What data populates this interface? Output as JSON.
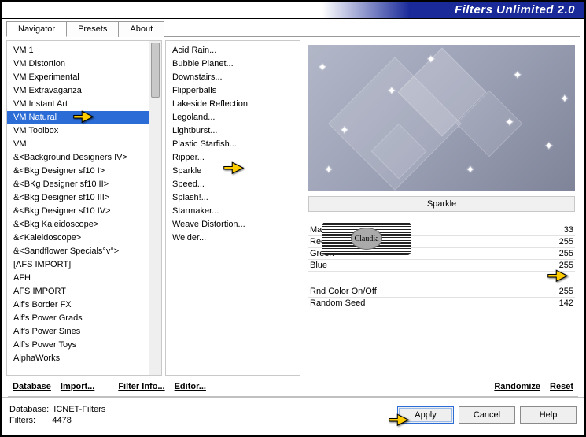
{
  "title": "Filters Unlimited 2.0",
  "tabs": [
    {
      "label": "Navigator",
      "active": true
    },
    {
      "label": "Presets",
      "active": false
    },
    {
      "label": "About",
      "active": false
    }
  ],
  "categories": [
    "VM 1",
    "VM Distortion",
    "VM Experimental",
    "VM Extravaganza",
    "VM Instant Art",
    "VM Natural",
    "VM Toolbox",
    "VM",
    "&<Background Designers IV>",
    "&<Bkg Designer sf10 I>",
    "&<BKg Designer sf10 II>",
    "&<Bkg Designer sf10 III>",
    "&<Bkg Designer sf10 IV>",
    "&<Bkg Kaleidoscope>",
    "&<Kaleidoscope>",
    "&<Sandflower Specials°v°>",
    "[AFS IMPORT]",
    "AFH",
    "AFS IMPORT",
    "Alf's Border FX",
    "Alf's Power Grads",
    "Alf's Power Sines",
    "Alf's Power Toys",
    "AlphaWorks"
  ],
  "selected_category_index": 5,
  "filters": [
    "Acid Rain...",
    "Bubble Planet...",
    "Downstairs...",
    "Flipperballs",
    "Lakeside Reflection",
    "Legoland...",
    "Lightburst...",
    "Plastic Starfish...",
    "Ripper...",
    "Sparkle",
    "Speed...",
    "Splash!...",
    "Starmaker...",
    "Weave Distortion...",
    "Welder..."
  ],
  "current_filter": "Sparkle",
  "params_a": [
    {
      "name": "Max Size",
      "value": 33
    },
    {
      "name": "Red",
      "value": 255
    },
    {
      "name": "Green",
      "value": 255
    },
    {
      "name": "Blue",
      "value": 255
    }
  ],
  "params_b": [
    {
      "name": "Rnd Color On/Off",
      "value": 255
    },
    {
      "name": "Random Seed",
      "value": 142
    }
  ],
  "links": {
    "database": "Database",
    "import": "Import...",
    "filter_info": "Filter Info...",
    "editor": "Editor...",
    "randomize": "Randomize",
    "reset": "Reset"
  },
  "footer": {
    "db_label": "Database:",
    "db_value": "ICNET-Filters",
    "filters_label": "Filters:",
    "filters_value": "4478",
    "apply": "Apply",
    "cancel": "Cancel",
    "help": "Help"
  },
  "watermark": "Claudia"
}
